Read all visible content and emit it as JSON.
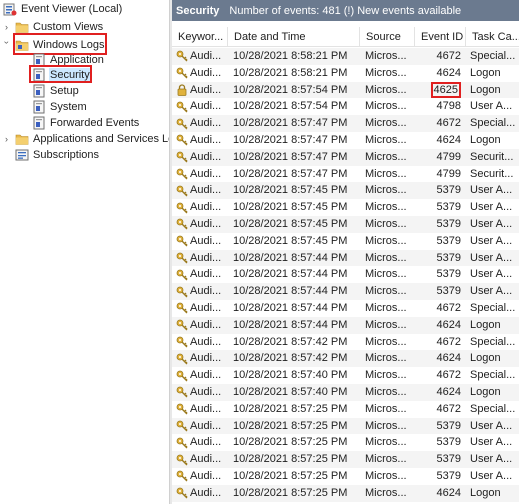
{
  "tree": {
    "root": {
      "label": "Event Viewer (Local)",
      "icon": "event-viewer-icon"
    },
    "custom_views": {
      "label": "Custom Views",
      "icon": "folder-icon"
    },
    "windows_logs": {
      "label": "Windows Logs",
      "icon": "folder-icon"
    },
    "logs": [
      {
        "label": "Application",
        "icon": "log-icon"
      },
      {
        "label": "Security",
        "icon": "log-icon",
        "selected": true
      },
      {
        "label": "Setup",
        "icon": "log-icon"
      },
      {
        "label": "System",
        "icon": "log-icon"
      },
      {
        "label": "Forwarded Events",
        "icon": "log-icon"
      }
    ],
    "apps_services": {
      "label": "Applications and Services Lo",
      "icon": "folder-icon"
    },
    "subscriptions": {
      "label": "Subscriptions",
      "icon": "subscriptions-icon"
    }
  },
  "log_header": {
    "name": "Security",
    "info": "Number of events: 481 (!) New events available"
  },
  "columns": {
    "keywords": "Keywor...",
    "date": "Date and Time",
    "source": "Source",
    "event_id": "Event ID",
    "task": "Task Ca..."
  },
  "events": [
    {
      "kw": "Audi...",
      "icon": "key-icon",
      "date": "10/28/2021 8:58:21 PM",
      "src": "Micros...",
      "eid": "4672",
      "task": "Special..."
    },
    {
      "kw": "Audi...",
      "icon": "key-icon",
      "date": "10/28/2021 8:58:21 PM",
      "src": "Micros...",
      "eid": "4624",
      "task": "Logon"
    },
    {
      "kw": "Audi...",
      "icon": "lock-icon",
      "date": "10/28/2021 8:57:54 PM",
      "src": "Micros...",
      "eid": "4625",
      "task": "Logon",
      "highlight": true
    },
    {
      "kw": "Audi...",
      "icon": "key-icon",
      "date": "10/28/2021 8:57:54 PM",
      "src": "Micros...",
      "eid": "4798",
      "task": "User A..."
    },
    {
      "kw": "Audi...",
      "icon": "key-icon",
      "date": "10/28/2021 8:57:47 PM",
      "src": "Micros...",
      "eid": "4672",
      "task": "Special..."
    },
    {
      "kw": "Audi...",
      "icon": "key-icon",
      "date": "10/28/2021 8:57:47 PM",
      "src": "Micros...",
      "eid": "4624",
      "task": "Logon"
    },
    {
      "kw": "Audi...",
      "icon": "key-icon",
      "date": "10/28/2021 8:57:47 PM",
      "src": "Micros...",
      "eid": "4799",
      "task": "Securit..."
    },
    {
      "kw": "Audi...",
      "icon": "key-icon",
      "date": "10/28/2021 8:57:47 PM",
      "src": "Micros...",
      "eid": "4799",
      "task": "Securit..."
    },
    {
      "kw": "Audi...",
      "icon": "key-icon",
      "date": "10/28/2021 8:57:45 PM",
      "src": "Micros...",
      "eid": "5379",
      "task": "User A..."
    },
    {
      "kw": "Audi...",
      "icon": "key-icon",
      "date": "10/28/2021 8:57:45 PM",
      "src": "Micros...",
      "eid": "5379",
      "task": "User A..."
    },
    {
      "kw": "Audi...",
      "icon": "key-icon",
      "date": "10/28/2021 8:57:45 PM",
      "src": "Micros...",
      "eid": "5379",
      "task": "User A..."
    },
    {
      "kw": "Audi...",
      "icon": "key-icon",
      "date": "10/28/2021 8:57:45 PM",
      "src": "Micros...",
      "eid": "5379",
      "task": "User A..."
    },
    {
      "kw": "Audi...",
      "icon": "key-icon",
      "date": "10/28/2021 8:57:44 PM",
      "src": "Micros...",
      "eid": "5379",
      "task": "User A..."
    },
    {
      "kw": "Audi...",
      "icon": "key-icon",
      "date": "10/28/2021 8:57:44 PM",
      "src": "Micros...",
      "eid": "5379",
      "task": "User A..."
    },
    {
      "kw": "Audi...",
      "icon": "key-icon",
      "date": "10/28/2021 8:57:44 PM",
      "src": "Micros...",
      "eid": "5379",
      "task": "User A..."
    },
    {
      "kw": "Audi...",
      "icon": "key-icon",
      "date": "10/28/2021 8:57:44 PM",
      "src": "Micros...",
      "eid": "4672",
      "task": "Special..."
    },
    {
      "kw": "Audi...",
      "icon": "key-icon",
      "date": "10/28/2021 8:57:44 PM",
      "src": "Micros...",
      "eid": "4624",
      "task": "Logon"
    },
    {
      "kw": "Audi...",
      "icon": "key-icon",
      "date": "10/28/2021 8:57:42 PM",
      "src": "Micros...",
      "eid": "4672",
      "task": "Special..."
    },
    {
      "kw": "Audi...",
      "icon": "key-icon",
      "date": "10/28/2021 8:57:42 PM",
      "src": "Micros...",
      "eid": "4624",
      "task": "Logon"
    },
    {
      "kw": "Audi...",
      "icon": "key-icon",
      "date": "10/28/2021 8:57:40 PM",
      "src": "Micros...",
      "eid": "4672",
      "task": "Special..."
    },
    {
      "kw": "Audi...",
      "icon": "key-icon",
      "date": "10/28/2021 8:57:40 PM",
      "src": "Micros...",
      "eid": "4624",
      "task": "Logon"
    },
    {
      "kw": "Audi...",
      "icon": "key-icon",
      "date": "10/28/2021 8:57:25 PM",
      "src": "Micros...",
      "eid": "4672",
      "task": "Special..."
    },
    {
      "kw": "Audi...",
      "icon": "key-icon",
      "date": "10/28/2021 8:57:25 PM",
      "src": "Micros...",
      "eid": "5379",
      "task": "User A..."
    },
    {
      "kw": "Audi...",
      "icon": "key-icon",
      "date": "10/28/2021 8:57:25 PM",
      "src": "Micros...",
      "eid": "5379",
      "task": "User A..."
    },
    {
      "kw": "Audi...",
      "icon": "key-icon",
      "date": "10/28/2021 8:57:25 PM",
      "src": "Micros...",
      "eid": "5379",
      "task": "User A..."
    },
    {
      "kw": "Audi...",
      "icon": "key-icon",
      "date": "10/28/2021 8:57:25 PM",
      "src": "Micros...",
      "eid": "5379",
      "task": "User A..."
    },
    {
      "kw": "Audi...",
      "icon": "key-icon",
      "date": "10/28/2021 8:57:25 PM",
      "src": "Micros...",
      "eid": "4624",
      "task": "Logon"
    }
  ],
  "colors": {
    "header_bg": "#6b7a8f",
    "highlight": "#e02020",
    "selection": "#cce8ff"
  }
}
